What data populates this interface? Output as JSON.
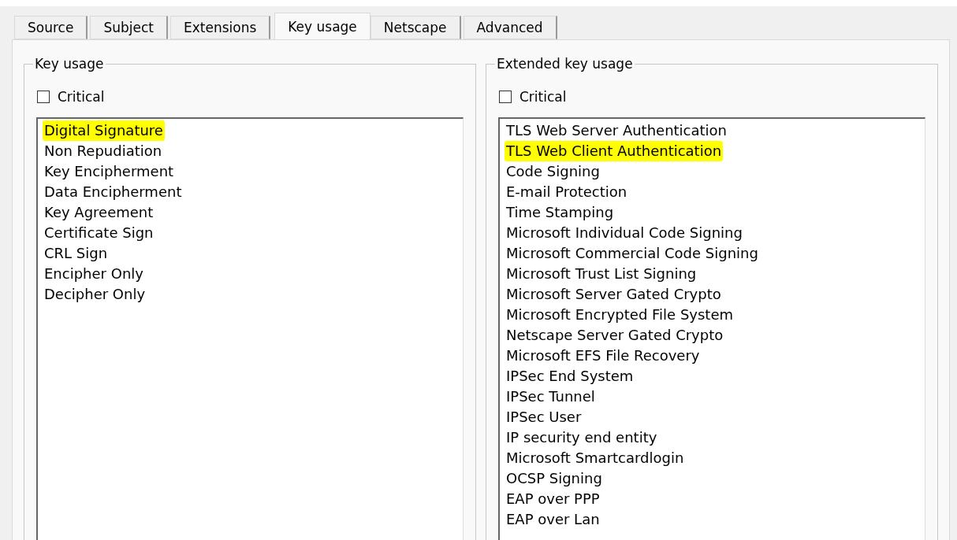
{
  "tabs": [
    {
      "label": "Source",
      "selected": false
    },
    {
      "label": "Subject",
      "selected": false
    },
    {
      "label": "Extensions",
      "selected": false
    },
    {
      "label": "Key usage",
      "selected": true
    },
    {
      "label": "Netscape",
      "selected": false
    },
    {
      "label": "Advanced",
      "selected": false
    }
  ],
  "groups": [
    {
      "title": "Key usage",
      "critical": {
        "label": "Critical",
        "checked": false
      },
      "items": [
        {
          "label": "Digital Signature",
          "highlighted": true
        },
        {
          "label": "Non Repudiation",
          "highlighted": false
        },
        {
          "label": "Key Encipherment",
          "highlighted": false
        },
        {
          "label": "Data Encipherment",
          "highlighted": false
        },
        {
          "label": "Key Agreement",
          "highlighted": false
        },
        {
          "label": "Certificate Sign",
          "highlighted": false
        },
        {
          "label": "CRL Sign",
          "highlighted": false
        },
        {
          "label": "Encipher Only",
          "highlighted": false
        },
        {
          "label": "Decipher Only",
          "highlighted": false
        }
      ]
    },
    {
      "title": "Extended key usage",
      "critical": {
        "label": "Critical",
        "checked": false
      },
      "items": [
        {
          "label": "TLS Web Server Authentication",
          "highlighted": false
        },
        {
          "label": "TLS Web Client Authentication",
          "highlighted": true
        },
        {
          "label": "Code Signing",
          "highlighted": false
        },
        {
          "label": "E-mail Protection",
          "highlighted": false
        },
        {
          "label": "Time Stamping",
          "highlighted": false
        },
        {
          "label": "Microsoft Individual Code Signing",
          "highlighted": false
        },
        {
          "label": "Microsoft Commercial Code Signing",
          "highlighted": false
        },
        {
          "label": "Microsoft Trust List Signing",
          "highlighted": false
        },
        {
          "label": "Microsoft Server Gated Crypto",
          "highlighted": false
        },
        {
          "label": "Microsoft Encrypted File System",
          "highlighted": false
        },
        {
          "label": "Netscape Server Gated Crypto",
          "highlighted": false
        },
        {
          "label": "Microsoft EFS File Recovery",
          "highlighted": false
        },
        {
          "label": "IPSec End System",
          "highlighted": false
        },
        {
          "label": "IPSec Tunnel",
          "highlighted": false
        },
        {
          "label": "IPSec User",
          "highlighted": false
        },
        {
          "label": "IP security end entity",
          "highlighted": false
        },
        {
          "label": "Microsoft Smartcardlogin",
          "highlighted": false
        },
        {
          "label": "OCSP Signing",
          "highlighted": false
        },
        {
          "label": "EAP over PPP",
          "highlighted": false
        },
        {
          "label": "EAP over Lan",
          "highlighted": false
        }
      ]
    }
  ]
}
